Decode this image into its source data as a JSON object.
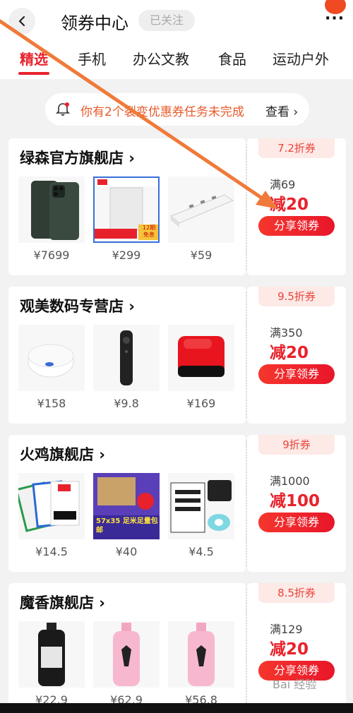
{
  "header": {
    "title": "领券中心",
    "follow_label": "已关注"
  },
  "tabs": [
    "精选",
    "手机",
    "办公文教",
    "食品",
    "运动户外"
  ],
  "notice": {
    "text": "你有2个裂变优惠券任务未完成",
    "link": "查看"
  },
  "shops": [
    {
      "name": "绿森官方旗舰店",
      "prices": [
        "¥7699",
        "¥299",
        "¥59"
      ],
      "discount": "7.2折券",
      "min": "满69",
      "reduce": "减20",
      "button": "分享领券"
    },
    {
      "name": "观美数码专营店",
      "prices": [
        "¥158",
        "¥9.8",
        "¥169"
      ],
      "discount": "9.5折券",
      "min": "满350",
      "reduce": "减20",
      "button": "分享领券"
    },
    {
      "name": "火鸡旗舰店",
      "prices": [
        "¥14.5",
        "¥40",
        "¥4.5"
      ],
      "discount": "9折券",
      "min": "满1000",
      "reduce": "减100",
      "button": "分享领券"
    },
    {
      "name": "魔香旗舰店",
      "prices": [
        "¥22.9",
        "¥62.9",
        "¥56.8"
      ],
      "discount": "8.5折券",
      "min": "满129",
      "reduce": "减20",
      "button": "分享领券"
    }
  ],
  "product_images": {
    "shop1": [
      "phone-image",
      "power-bank-image",
      "power-strip-image"
    ],
    "shop1_labels": [
      "",
      "12期 免息",
      ""
    ],
    "shop2": [
      "round-device-image",
      "remote-control-image",
      "tv-box-image"
    ],
    "shop3": [
      "label-cards-image",
      "paper-rolls-box-image",
      "label-printer-image"
    ],
    "shop3_labels": [
      "",
      "57x35 足米足量包邮",
      ""
    ],
    "shop4": [
      "black-bottle-image",
      "pink-bottle-image",
      "pink-bottle-image"
    ]
  },
  "watermark": "Bai 经验",
  "colors": {
    "accent": "#e8222c",
    "arrow": "#f07a3a",
    "notice_text": "#e85a2a"
  }
}
